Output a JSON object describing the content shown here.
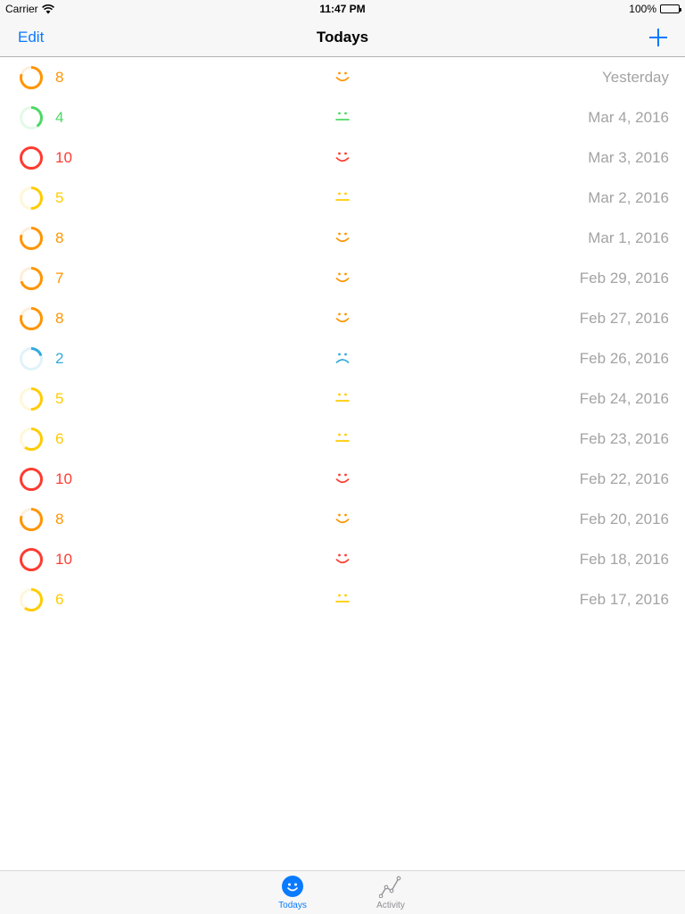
{
  "status_bar": {
    "carrier": "Carrier",
    "time": "11:47 PM",
    "battery": "100%"
  },
  "nav": {
    "edit_label": "Edit",
    "title": "Todays",
    "add_icon": "plus-icon"
  },
  "colors": {
    "accent": "#0a7aff",
    "orange": "#ff9500",
    "green": "#4cd964",
    "red": "#ff3b30",
    "yellow": "#ffcc00",
    "blue": "#34aadc",
    "date_gray": "#a3a3a3"
  },
  "entries": [
    {
      "score": "8",
      "level": 0.8,
      "mood": "happy",
      "color": "#ff9500",
      "date": "Yesterday"
    },
    {
      "score": "4",
      "level": 0.4,
      "mood": "neutral",
      "color": "#4cd964",
      "date": "Mar 4, 2016"
    },
    {
      "score": "10",
      "level": 1.0,
      "mood": "happy",
      "color": "#ff3b30",
      "date": "Mar 3, 2016"
    },
    {
      "score": "5",
      "level": 0.5,
      "mood": "neutral",
      "color": "#ffcc00",
      "date": "Mar 2, 2016"
    },
    {
      "score": "8",
      "level": 0.8,
      "mood": "happy",
      "color": "#ff9500",
      "date": "Mar 1, 2016"
    },
    {
      "score": "7",
      "level": 0.7,
      "mood": "happy",
      "color": "#ff9500",
      "date": "Feb 29, 2016"
    },
    {
      "score": "8",
      "level": 0.8,
      "mood": "happy",
      "color": "#ff9500",
      "date": "Feb 27, 2016"
    },
    {
      "score": "2",
      "level": 0.2,
      "mood": "sad",
      "color": "#34aadc",
      "date": "Feb 26, 2016"
    },
    {
      "score": "5",
      "level": 0.5,
      "mood": "neutral",
      "color": "#ffcc00",
      "date": "Feb 24, 2016"
    },
    {
      "score": "6",
      "level": 0.6,
      "mood": "neutral",
      "color": "#ffcc00",
      "date": "Feb 23, 2016"
    },
    {
      "score": "10",
      "level": 1.0,
      "mood": "happy",
      "color": "#ff3b30",
      "date": "Feb 22, 2016"
    },
    {
      "score": "8",
      "level": 0.8,
      "mood": "happy",
      "color": "#ff9500",
      "date": "Feb 20, 2016"
    },
    {
      "score": "10",
      "level": 1.0,
      "mood": "happy",
      "color": "#ff3b30",
      "date": "Feb 18, 2016"
    },
    {
      "score": "6",
      "level": 0.6,
      "mood": "neutral",
      "color": "#ffcc00",
      "date": "Feb 17, 2016"
    }
  ],
  "tabs": [
    {
      "label": "Todays",
      "icon": "smiley-icon",
      "active": true
    },
    {
      "label": "Activity",
      "icon": "activity-graph-icon",
      "active": false
    }
  ]
}
